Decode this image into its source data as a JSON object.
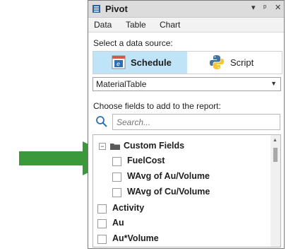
{
  "window": {
    "title": "Pivot",
    "icon": "menu-lines-icon",
    "controls": [
      "▾",
      "ᵖ",
      "✕"
    ]
  },
  "menu": {
    "items": [
      "Data",
      "Table",
      "Chart"
    ]
  },
  "source": {
    "prompt": "Select a data source:",
    "options": [
      {
        "label": "Schedule",
        "icon": "schedule-icon",
        "selected": true
      },
      {
        "label": "Script",
        "icon": "python-icon",
        "selected": false
      }
    ]
  },
  "table_select": {
    "value": "MaterialTable"
  },
  "fields": {
    "prompt": "Choose fields to add to the report:",
    "search_placeholder": "Search...",
    "group": {
      "label": "Custom Fields",
      "expanded": true
    },
    "group_items": [
      "FuelCost",
      "WAvg of Au/Volume",
      "WAvg of Cu/Volume"
    ],
    "items": [
      "Activity",
      "Au",
      "Au*Volume"
    ]
  },
  "colors": {
    "accent": "#bfe3f7",
    "arrow": "#3a9a3a",
    "titlebar": "#dcdcdc"
  }
}
